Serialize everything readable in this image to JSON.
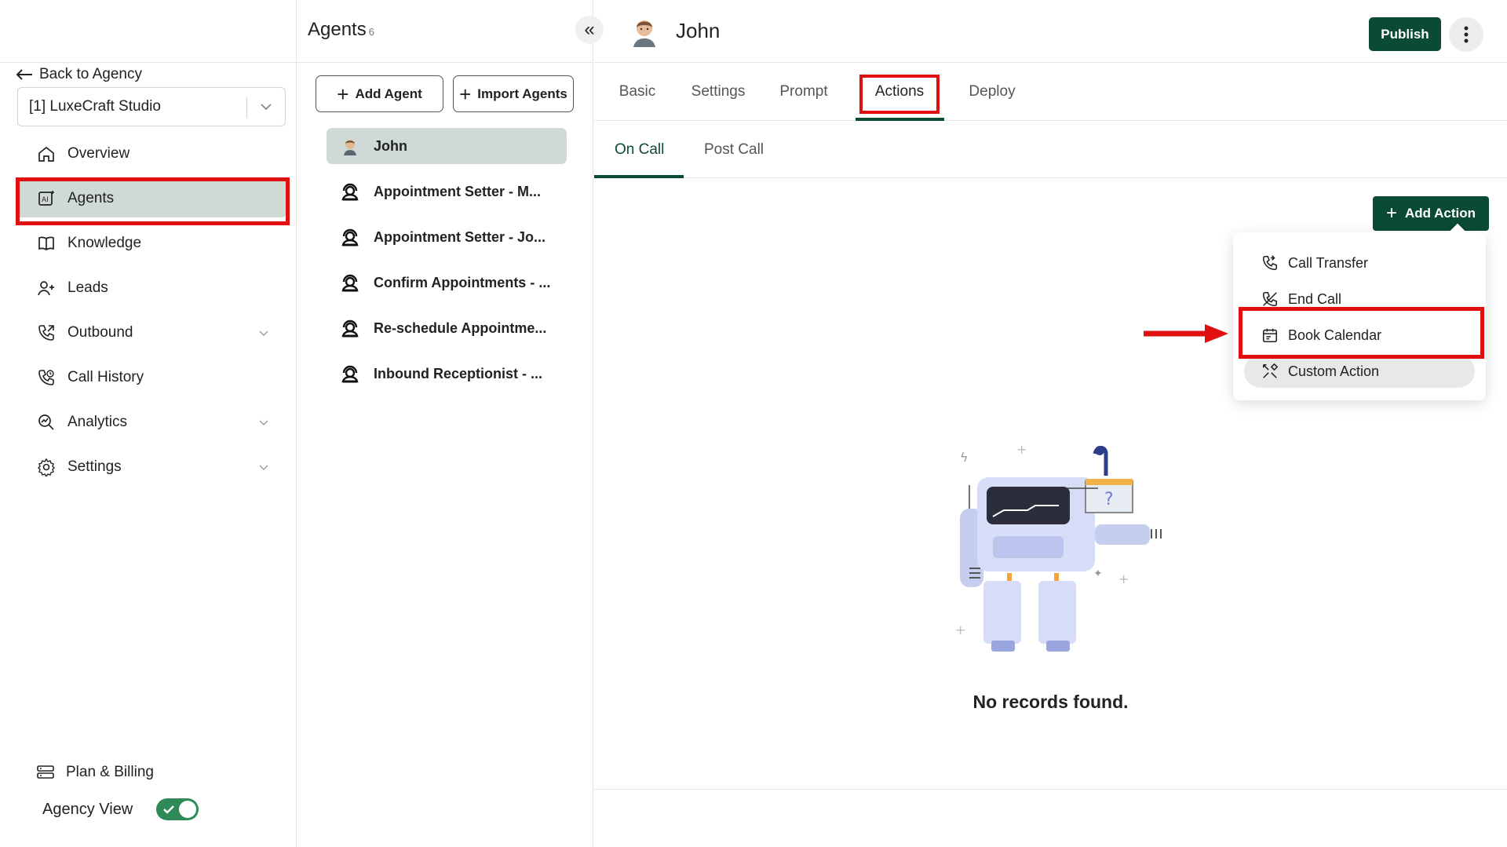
{
  "sidebar": {
    "back_label": "Back to Agency",
    "agency_select": "[1] LuxeCraft Studio",
    "nav": [
      {
        "label": "Overview"
      },
      {
        "label": "Agents"
      },
      {
        "label": "Knowledge"
      },
      {
        "label": "Leads"
      },
      {
        "label": "Outbound"
      },
      {
        "label": "Call History"
      },
      {
        "label": "Analytics"
      },
      {
        "label": "Settings"
      }
    ],
    "plan_billing": "Plan & Billing",
    "agency_view": "Agency View",
    "agency_view_on": true
  },
  "agents_panel": {
    "title": "Agents",
    "count": "6",
    "collapse_glyph": "«",
    "add_agent": "Add Agent",
    "import_agents": "Import Agents",
    "agents": [
      {
        "name": "John"
      },
      {
        "name": "Appointment Setter - M..."
      },
      {
        "name": "Appointment Setter - Jo..."
      },
      {
        "name": "Confirm Appointments - ..."
      },
      {
        "name": "Re-schedule Appointme..."
      },
      {
        "name": "Inbound Receptionist - ..."
      }
    ]
  },
  "main": {
    "agent_name": "John",
    "publish": "Publish",
    "tabs": [
      "Basic",
      "Settings",
      "Prompt",
      "Actions",
      "Deploy"
    ],
    "active_tab": "Actions",
    "subtabs": [
      "On Call",
      "Post Call"
    ],
    "active_subtab": "On Call",
    "add_action": "Add Action",
    "action_menu": [
      "Call Transfer",
      "End Call",
      "Book Calendar",
      "Custom Action"
    ],
    "empty_text": "No records found."
  },
  "colors": {
    "brand": "#0b4a34",
    "active_bg": "#cfd9d6",
    "highlight": "#e01010",
    "toggle_on": "#2e8b57"
  },
  "icons": [
    "arrow-left-icon",
    "chevron-down-icon",
    "home-icon",
    "ai-icon",
    "book-icon",
    "user-plus-icon",
    "phone-outgoing-icon",
    "call-history-icon",
    "analytics-icon",
    "gear-icon",
    "billing-icon",
    "headset-icon",
    "more-vertical-icon",
    "phone-transfer-icon",
    "phone-off-icon",
    "calendar-icon",
    "tools-icon"
  ]
}
